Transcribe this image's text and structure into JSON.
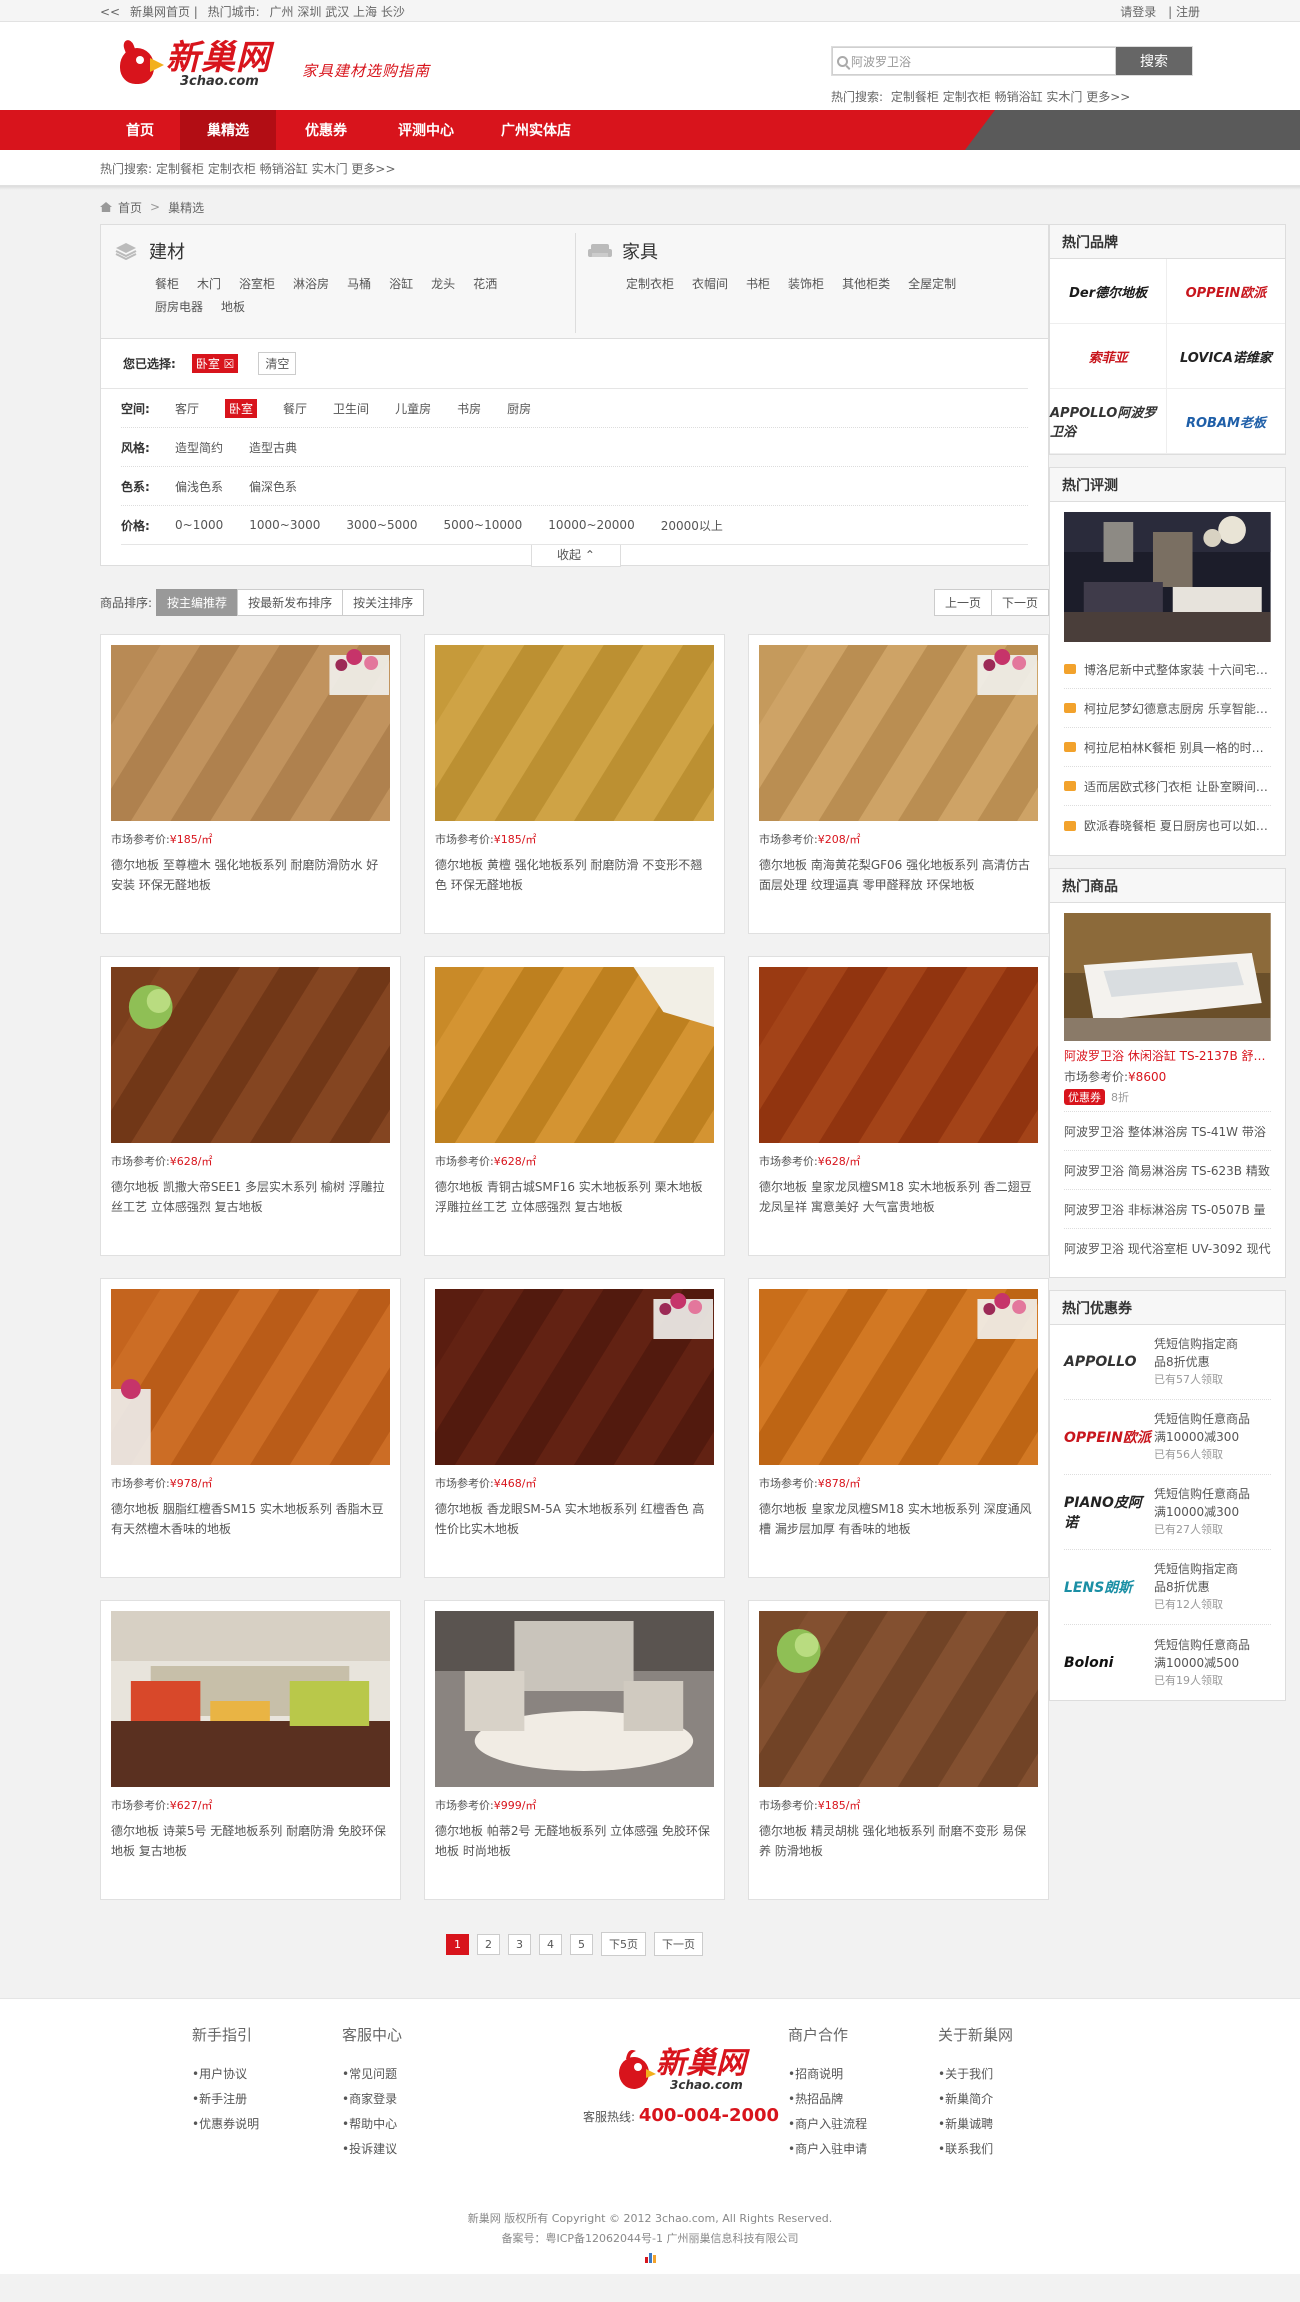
{
  "topbar": {
    "home_link": "新巢网首页",
    "hot_city_label": "热门城市:",
    "cities": [
      "广州",
      "深圳",
      "武汉",
      "上海",
      "长沙"
    ],
    "login": "请登录",
    "register": "注册"
  },
  "header": {
    "logo_cn": "新巢网",
    "logo_en": "3chao.com",
    "slogan": "家具建材选购指南",
    "search_placeholder": "阿波罗卫浴",
    "search_button": "搜索",
    "hot_label": "热门搜索:",
    "hot_terms": [
      "定制餐柜",
      "定制衣柜",
      "畅销浴缸",
      "实木门",
      "更多>>"
    ]
  },
  "nav": {
    "items": [
      {
        "label": "首页",
        "active": false
      },
      {
        "label": "巢精选",
        "active": true
      },
      {
        "label": "优惠券",
        "active": false
      },
      {
        "label": "评测中心",
        "active": false
      },
      {
        "label": "广州实体店",
        "active": false
      }
    ]
  },
  "subbar": {
    "hot_label": "热门搜索:",
    "terms": [
      "定制餐柜",
      "定制衣柜",
      "畅销浴缸",
      "实木门",
      "更多>>"
    ]
  },
  "breadcrumb": {
    "home": "首页",
    "current": "巢精选"
  },
  "categories": [
    {
      "title": "建材",
      "items": [
        "餐柜",
        "木门",
        "浴室柜",
        "淋浴房",
        "马桶",
        "浴缸",
        "龙头",
        "花洒",
        "厨房电器",
        "地板"
      ]
    },
    {
      "title": "家具",
      "items": [
        "定制衣柜",
        "衣帽间",
        "书柜",
        "装饰柜",
        "其他柜类",
        "全屋定制"
      ]
    }
  ],
  "chosen": {
    "label": "您已选择:",
    "tag": "卧室",
    "clear": "清空"
  },
  "filters": [
    {
      "label": "空间:",
      "values": [
        "客厅",
        "卧室",
        "餐厅",
        "卫生间",
        "儿童房",
        "书房",
        "厨房"
      ],
      "selected": 1
    },
    {
      "label": "风格:",
      "values": [
        "造型简约",
        "造型古典"
      ],
      "selected": -1
    },
    {
      "label": "色系:",
      "values": [
        "偏浅色系",
        "偏深色系"
      ],
      "selected": -1
    },
    {
      "label": "价格:",
      "values": [
        "0~1000",
        "1000~3000",
        "3000~5000",
        "5000~10000",
        "10000~20000",
        "20000以上"
      ],
      "selected": -1
    }
  ],
  "collapse_label": "收起",
  "sort": {
    "label": "商品排序:",
    "options": [
      "按主编推荐",
      "按最新发布排序",
      "按关注排序"
    ],
    "active": 0,
    "prev": "上一页",
    "next": "下一页"
  },
  "price_label": "市场参考价:",
  "products": [
    {
      "price": "¥185/㎡",
      "desc": "德尔地板 至尊檀木 强化地板系列 耐磨防滑防水 好安装 环保无醛地板",
      "img": "light-wood"
    },
    {
      "price": "¥185/㎡",
      "desc": "德尔地板 黄檀 强化地板系列 耐磨防滑 不变形不翘色 环保无醛地板",
      "img": "yellow-wood"
    },
    {
      "price": "¥208/㎡",
      "desc": "德尔地板 南海黄花梨GF06 强化地板系列 高清仿古面层处理 纹理逼真 零甲醛释放 环保地板",
      "img": "light-wood-flowers"
    },
    {
      "price": "¥628/㎡",
      "desc": "德尔地板 凯撒大帝SEE1 多层实木系列 榆树 浮雕拉丝工艺 立体感强烈 复古地板",
      "img": "dark-wood-green"
    },
    {
      "price": "¥628/㎡",
      "desc": "德尔地板 青铜古城SMF16 实木地板系列 栗木地板 浮雕拉丝工艺 立体感强烈 复古地板",
      "img": "gold-wood"
    },
    {
      "price": "¥628/㎡",
      "desc": "德尔地板 皇家龙凤檀SM18 实木地板系列 香二翅豆 龙凤呈祥 寓意美好 大气富贵地板",
      "img": "red-wood"
    },
    {
      "price": "¥978/㎡",
      "desc": "德尔地板 胭脂红檀香SM15 实木地板系列 香脂木豆 有天然檀木香味的地板",
      "img": "orange-wood"
    },
    {
      "price": "¥468/㎡",
      "desc": "德尔地板 香龙眼SM-5A 实木地板系列 红檀香色 高性价比实木地板",
      "img": "dark-red-wood"
    },
    {
      "price": "¥878/㎡",
      "desc": "德尔地板 皇家龙凤檀SM18 实木地板系列 深度通风槽 漏步层加厚 有香味的地板",
      "img": "amber-wood"
    },
    {
      "price": "¥627/㎡",
      "desc": "德尔地板 诗莱5号 无醛地板系列 耐磨防滑 免胶环保地板 复古地板",
      "img": "room-sofa"
    },
    {
      "price": "¥999/㎡",
      "desc": "德尔地板 帕蒂2号 无醛地板系列 立体感强 免胶环保地板 时尚地板",
      "img": "room-rug"
    },
    {
      "price": "¥185/㎡",
      "desc": "德尔地板 精灵胡桃 强化地板系列 耐磨不变形 易保养 防滑地板",
      "img": "walnut-wood"
    }
  ],
  "pagination": {
    "pages": [
      "1",
      "2",
      "3",
      "4",
      "5"
    ],
    "current": 0,
    "next5": "下5页",
    "next": "下一页"
  },
  "sidebar": {
    "brands_title": "热门品牌",
    "brands": [
      {
        "name": "Der德尔地板",
        "color": "#1a1a1a"
      },
      {
        "name": "OPPEIN欧派",
        "color": "#c8161d"
      },
      {
        "name": "索菲亚",
        "color": "#c8161d"
      },
      {
        "name": "LOVICA诺维家",
        "color": "#222222"
      },
      {
        "name": "APPOLLO阿波罗卫浴",
        "color": "#333333"
      },
      {
        "name": "ROBAM老板",
        "color": "#1f5fa8"
      }
    ],
    "reviews_title": "热门评测",
    "reviews": [
      "博洛尼新中式整体家装 十六间宅…",
      "柯拉尼梦幻德意志厨房 乐享智能…",
      "柯拉尼柏林K餐柜 别具一格的时…",
      "适而居欧式移门衣柜 让卧室瞬间…",
      "欧派春晓餐柜 夏日厨房也可以如…"
    ],
    "products_title": "热门商品",
    "featured": {
      "name": "阿波罗卫浴 休闲浴缸 TS-2137B 舒…",
      "price_label": "市场参考价:",
      "price": "¥8600",
      "badge": "优惠券",
      "discount": "8折"
    },
    "product_list": [
      "阿波罗卫浴 整体淋浴房 TS-41W 带浴",
      "阿波罗卫浴 简易淋浴房 TS-623B 精致",
      "阿波罗卫浴 非标淋浴房 TS-0507B 量",
      "阿波罗卫浴 现代浴室柜 UV-3092 现代"
    ],
    "coupons_title": "热门优惠券",
    "coupons": [
      {
        "brand": "APPOLLO",
        "color": "#333333",
        "line1": "凭短信购指定商",
        "line2": "品8折优惠",
        "count": "已有57人领取"
      },
      {
        "brand": "OPPEIN欧派",
        "color": "#c8161d",
        "line1": "凭短信购任意商品",
        "line2": "满10000减300",
        "count": "已有56人领取"
      },
      {
        "brand": "PIANO皮阿诺",
        "color": "#222222",
        "line1": "凭短信购任意商品",
        "line2": "满10000减300",
        "count": "已有27人领取"
      },
      {
        "brand": "LENS朗斯",
        "color": "#1b8fa5",
        "line1": "凭短信购指定商",
        "line2": "品8折优惠",
        "count": "已有12人领取"
      },
      {
        "brand": "Boloni",
        "color": "#111111",
        "line1": "凭短信购任意商品",
        "line2": "满10000减500",
        "count": "已有19人领取"
      }
    ]
  },
  "footer": {
    "cols": [
      {
        "title": "新手指引",
        "items": [
          "用户协议",
          "新手注册",
          "优惠券说明"
        ]
      },
      {
        "title": "客服中心",
        "items": [
          "常见问题",
          "商家登录",
          "帮助中心",
          "投诉建议"
        ]
      },
      {
        "title": "商户合作",
        "items": [
          "招商说明",
          "热招品牌",
          "商户入驻流程",
          "商户入驻申请"
        ]
      },
      {
        "title": "关于新巢网",
        "items": [
          "关于我们",
          "新巢简介",
          "新巢诚聘",
          "联系我们"
        ]
      }
    ],
    "logo_cn": "新巢网",
    "logo_en": "3chao.com",
    "tel_label": "客服热线:",
    "tel": "400-004-2000",
    "copyright": "新巢网 版权所有 Copyright © 2012 3chao.com, All Rights Reserved.",
    "icp": "备案号：粤ICP备12062044号-1 广州丽巢信息科技有限公司"
  },
  "colors": {
    "brand_red": "#d8141c",
    "nav_dark": "#5a5a5a"
  }
}
